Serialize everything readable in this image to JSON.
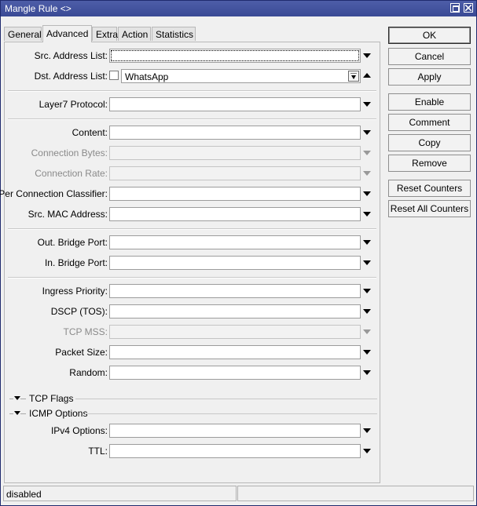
{
  "window": {
    "title": "Mangle Rule <>"
  },
  "tabs": [
    "General",
    "Advanced",
    "Extra",
    "Action",
    "Statistics"
  ],
  "active_tab": "Advanced",
  "fields": {
    "src_address_list": {
      "label": "Src. Address List:",
      "value": ""
    },
    "dst_address_list": {
      "label": "Dst. Address List:",
      "value": "WhatsApp",
      "negate": false
    },
    "layer7_protocol": {
      "label": "Layer7 Protocol:",
      "value": ""
    },
    "content": {
      "label": "Content:",
      "value": ""
    },
    "connection_bytes": {
      "label": "Connection Bytes:",
      "value": "",
      "disabled": true
    },
    "connection_rate": {
      "label": "Connection Rate:",
      "value": "",
      "disabled": true
    },
    "per_connection_classifier": {
      "label": "Per Connection Classifier:",
      "value": ""
    },
    "src_mac_address": {
      "label": "Src. MAC Address:",
      "value": ""
    },
    "out_bridge_port": {
      "label": "Out. Bridge Port:",
      "value": ""
    },
    "in_bridge_port": {
      "label": "In. Bridge Port:",
      "value": ""
    },
    "ingress_priority": {
      "label": "Ingress Priority:",
      "value": ""
    },
    "dscp_tos": {
      "label": "DSCP (TOS):",
      "value": ""
    },
    "tcp_mss": {
      "label": "TCP MSS:",
      "value": "",
      "disabled": true
    },
    "packet_size": {
      "label": "Packet Size:",
      "value": ""
    },
    "random": {
      "label": "Random:",
      "value": ""
    },
    "ipv4_options": {
      "label": "IPv4 Options:",
      "value": ""
    },
    "ttl": {
      "label": "TTL:",
      "value": ""
    }
  },
  "sections": {
    "tcp_flags": "TCP Flags",
    "icmp_options": "ICMP Options"
  },
  "buttons": {
    "ok": "OK",
    "cancel": "Cancel",
    "apply": "Apply",
    "enable": "Enable",
    "comment": "Comment",
    "copy": "Copy",
    "remove": "Remove",
    "reset_counters": "Reset Counters",
    "reset_all_counters": "Reset All Counters"
  },
  "status": {
    "state": "disabled",
    "extra": ""
  }
}
